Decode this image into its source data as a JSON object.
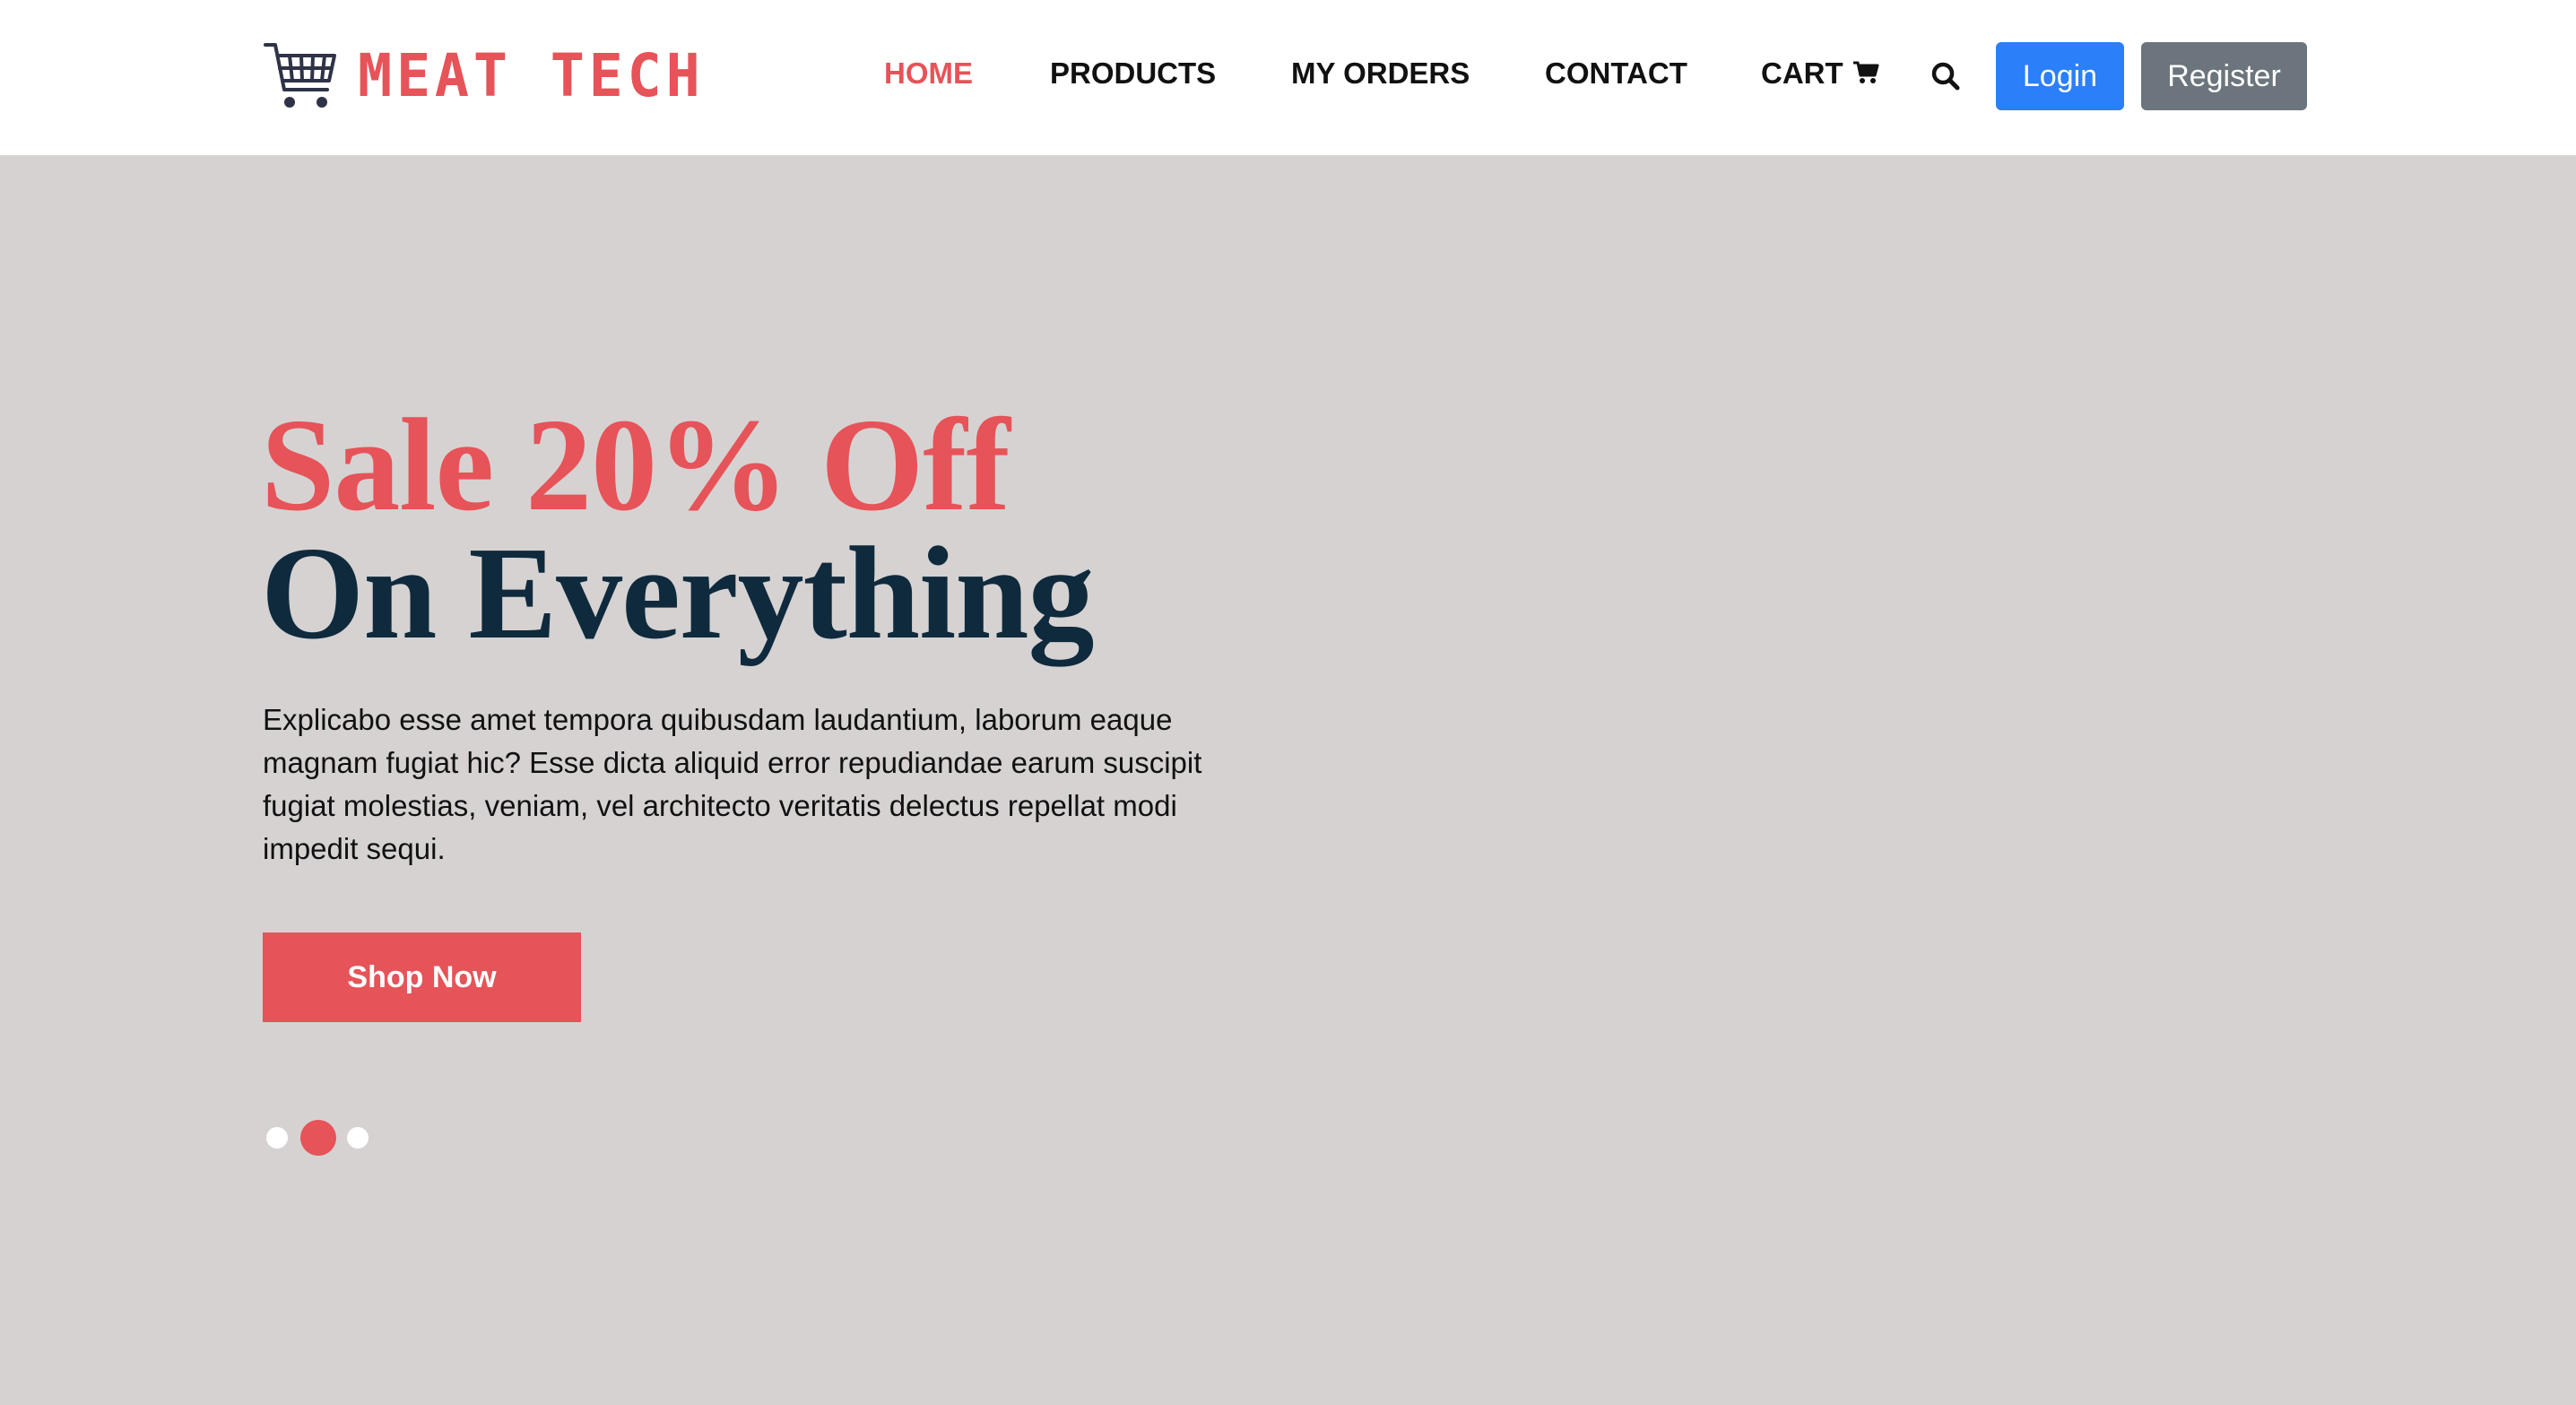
{
  "brand": {
    "name": "MEAT TECH",
    "icon": "shopping-cart-icon",
    "color": "#e65358"
  },
  "nav": {
    "items": [
      {
        "label": "HOME",
        "active": true
      },
      {
        "label": "PRODUCTS",
        "active": false
      },
      {
        "label": "MY ORDERS",
        "active": false
      },
      {
        "label": "CONTACT",
        "active": false
      },
      {
        "label": "CART",
        "active": false,
        "icon": "cart-icon"
      }
    ],
    "search_icon": "search-icon",
    "login_label": "Login",
    "register_label": "Register"
  },
  "hero": {
    "title_line1": "Sale 20% Off",
    "title_line2": "On Everything",
    "description": "Explicabo esse amet tempora quibusdam laudantium, laborum eaque magnam fugiat hic? Esse dicta aliquid error repudiandae earum suscipit fugiat molestias, veniam, vel architecto veritatis delectus repellat modi impedit sequi.",
    "cta_label": "Shop Now",
    "carousel": {
      "slides": 3,
      "active_index": 1
    }
  },
  "colors": {
    "accent": "#e65358",
    "heading_dark": "#0f2a3d",
    "login_blue": "#2b7ff8",
    "register_gray": "#6c757d",
    "hero_bg": "#d6d2d2"
  }
}
